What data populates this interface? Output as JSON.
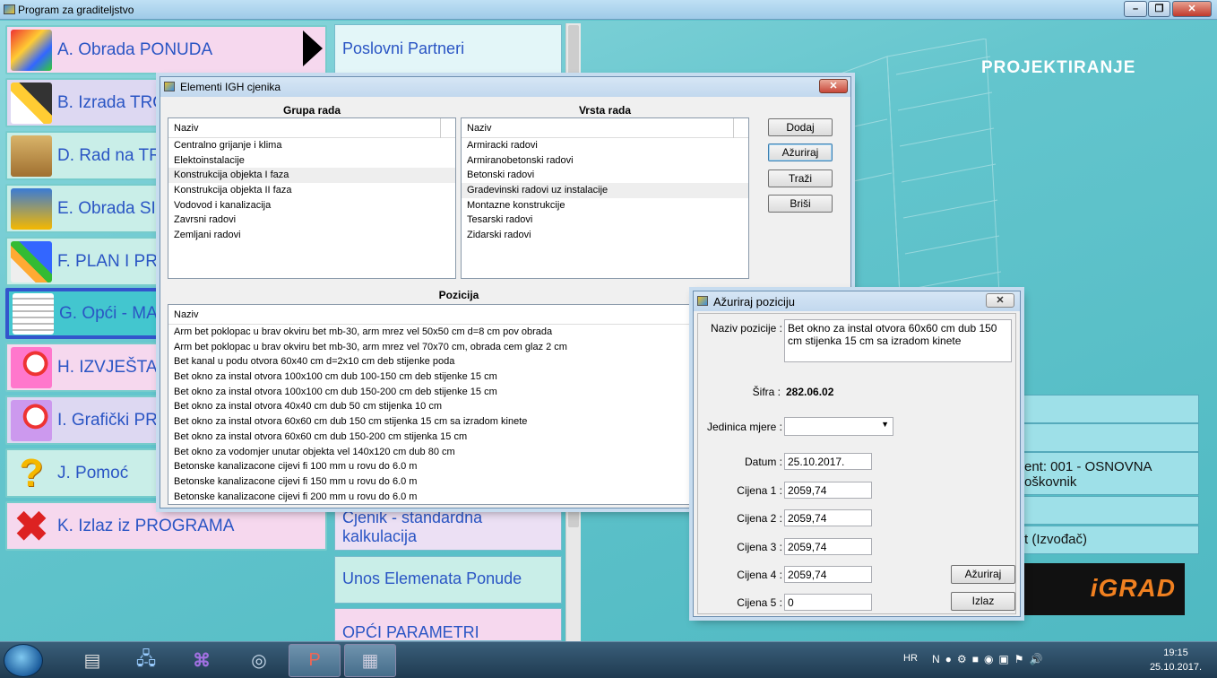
{
  "window": {
    "title": "Program za graditeljstvo"
  },
  "brand": {
    "section": "PROJEKTIRANJE",
    "logo": "iGRAD"
  },
  "left_menu": [
    {
      "label": "A. Obrada PONUDA",
      "icon": "tag-icon"
    },
    {
      "label": "B. Izrada TRO",
      "icon": "pencil-icon"
    },
    {
      "label": "D. Rad na TR",
      "icon": "folders-icon"
    },
    {
      "label": "E. Obrada SIT",
      "icon": "calculator-icon"
    },
    {
      "label": "F. PLAN I PRA",
      "icon": "chart-icon"
    },
    {
      "label": "G. Opći - MAT",
      "icon": "list-icon"
    },
    {
      "label": "H. IZVJEŠTA",
      "icon": "magnifier-icon"
    },
    {
      "label": "I. Grafički PRI",
      "icon": "magnifier-icon"
    },
    {
      "label": "J. Pomoć",
      "icon": "question-icon"
    },
    {
      "label": "K. Izlaz iz PROGRAMA",
      "icon": "close-x-icon"
    }
  ],
  "mid_menu": {
    "top": "Poslovni Partneri",
    "bottom": [
      "Cjenik - standardna kalkulacija",
      "Unos Elemenata Ponude",
      "OPĆI PARAMETRI"
    ]
  },
  "right_panel": {
    "row3_line1": "ent: 001 - OSNOVNA",
    "row3_line2": "oškovnik",
    "row5": "t (Izvođač)"
  },
  "igh_dialog": {
    "title": "Elementi IGH cjenika",
    "grupa_header": "Grupa rada",
    "vrsta_header": "Vrsta rada",
    "pozicija_header": "Pozicija",
    "col_naziv": "Naziv",
    "grupa_items": [
      "Centralno grijanje i klima",
      "Elektoinstalacije",
      "Konstrukcija objekta I faza",
      "Konstrukcija objekta II faza",
      "Vodovod i kanalizacija",
      "Zavrsni radovi",
      "Zemljani radovi"
    ],
    "vrsta_items": [
      "Armiracki radovi",
      "Armiranobetonski radovi",
      "Betonski radovi",
      "Gradevinski radovi uz instalacije",
      "Montazne konstrukcije",
      "Tesarski radovi",
      "Zidarski radovi"
    ],
    "pozicija_items": [
      "Arm bet poklopac u brav okviru bet mb-30, arm mrez vel 50x50 cm d=8 cm pov obrada",
      "Arm bet poklopac u brav okviru bet mb-30, arm mrez vel 70x70 cm, obrada cem glaz 2 cm",
      "Bet kanal u podu otvora 60x40 cm d=2x10 cm deb stijenke poda",
      "Bet okno za instal otvora 100x100 cm dub 100-150 cm deb stijenke 15 cm",
      "Bet okno za instal otvora 100x100 cm dub 150-200 cm deb stijenke 15 cm",
      "Bet okno za instal otvora 40x40 cm dub 50 cm stijenka 10 cm",
      "Bet okno za instal otvora 60x60 cm dub 150 cm stijenka 15 cm sa izradom kinete",
      "Bet okno za instal otvora 60x60 cm dub 150-200 cm stijenka 15 cm",
      "Bet okno za vodomjer unutar objekta vel 140x120 cm dub 80 cm",
      "Betonske kanalizacone cijevi fi 100 mm u rovu do 6.0 m",
      "Betonske kanalizacone cijevi fi 150 mm u rovu do 6.0 m",
      "Betonske kanalizacone cijevi fi 200 mm u rovu do 6.0 m"
    ],
    "buttons": {
      "dodaj": "Dodaj",
      "azuriraj": "Ažuriraj",
      "trazi": "Traži",
      "brisi": "Briši"
    },
    "close": "✕"
  },
  "edit_dialog": {
    "title": "Ažuriraj poziciju",
    "naziv_label": "Naziv pozicije :",
    "naziv_value": "Bet okno za instal otvora 60x60 cm dub 150 cm stijenka 15 cm sa izradom kinete",
    "sifra_label": "Šifra :",
    "sifra_value": "282.06.02",
    "jedinica_label": "Jedinica mjere :",
    "jedinica_value": "",
    "datum_label": "Datum :",
    "datum_value": "25.10.2017.",
    "cijena1_label": "Cijena 1 :",
    "cijena1_value": "2059,74",
    "cijena2_label": "Cijena 2 :",
    "cijena2_value": "2059,74",
    "cijena3_label": "Cijena 3 :",
    "cijena3_value": "2059,74",
    "cijena4_label": "Cijena 4 :",
    "cijena4_value": "2059,74",
    "cijena5_label": "Cijena 5 :",
    "cijena5_value": "0",
    "azuriraj_btn": "Ažuriraj",
    "izlaz_btn": "Izlaz",
    "close": "✕"
  },
  "taskbar": {
    "lang": "HR",
    "time": "19:15",
    "date": "25.10.2017."
  }
}
